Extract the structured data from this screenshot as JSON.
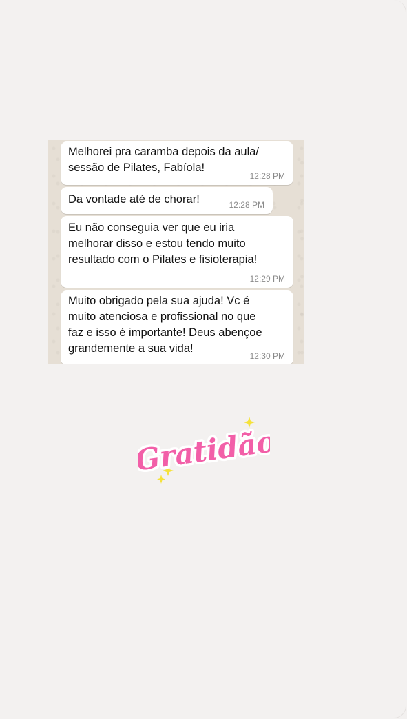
{
  "chat": {
    "messages": [
      {
        "text": "Melhorei pra caramba depois da aula/\nsessão de Pilates, Fabíola!",
        "time": "12:28 PM"
      },
      {
        "text": "Da vontade até de chorar!",
        "time": "12:28 PM"
      },
      {
        "text": "Eu não conseguia ver que eu iria\nmelhorar disso e estou tendo muito\nresultado com o Pilates e fisioterapia!",
        "time": "12:29 PM"
      },
      {
        "text": "Muito obrigado pela sua ajuda! Vc é\nmuito atenciosa e profissional no que\nfaz e isso é importante! Deus abençoe\ngrandemente a sua vida!",
        "time": "12:30 PM"
      }
    ]
  },
  "sticker": {
    "text": "Gratidão",
    "colors": {
      "text": "#f25fa8",
      "sparkle": "#f5e23a",
      "shadow": "#ffffff"
    }
  },
  "colors": {
    "background": "#f3f1f0",
    "chat_wallpaper": "#e6dfd5",
    "bubble": "#ffffff",
    "timestamp": "#8a8a8a"
  }
}
